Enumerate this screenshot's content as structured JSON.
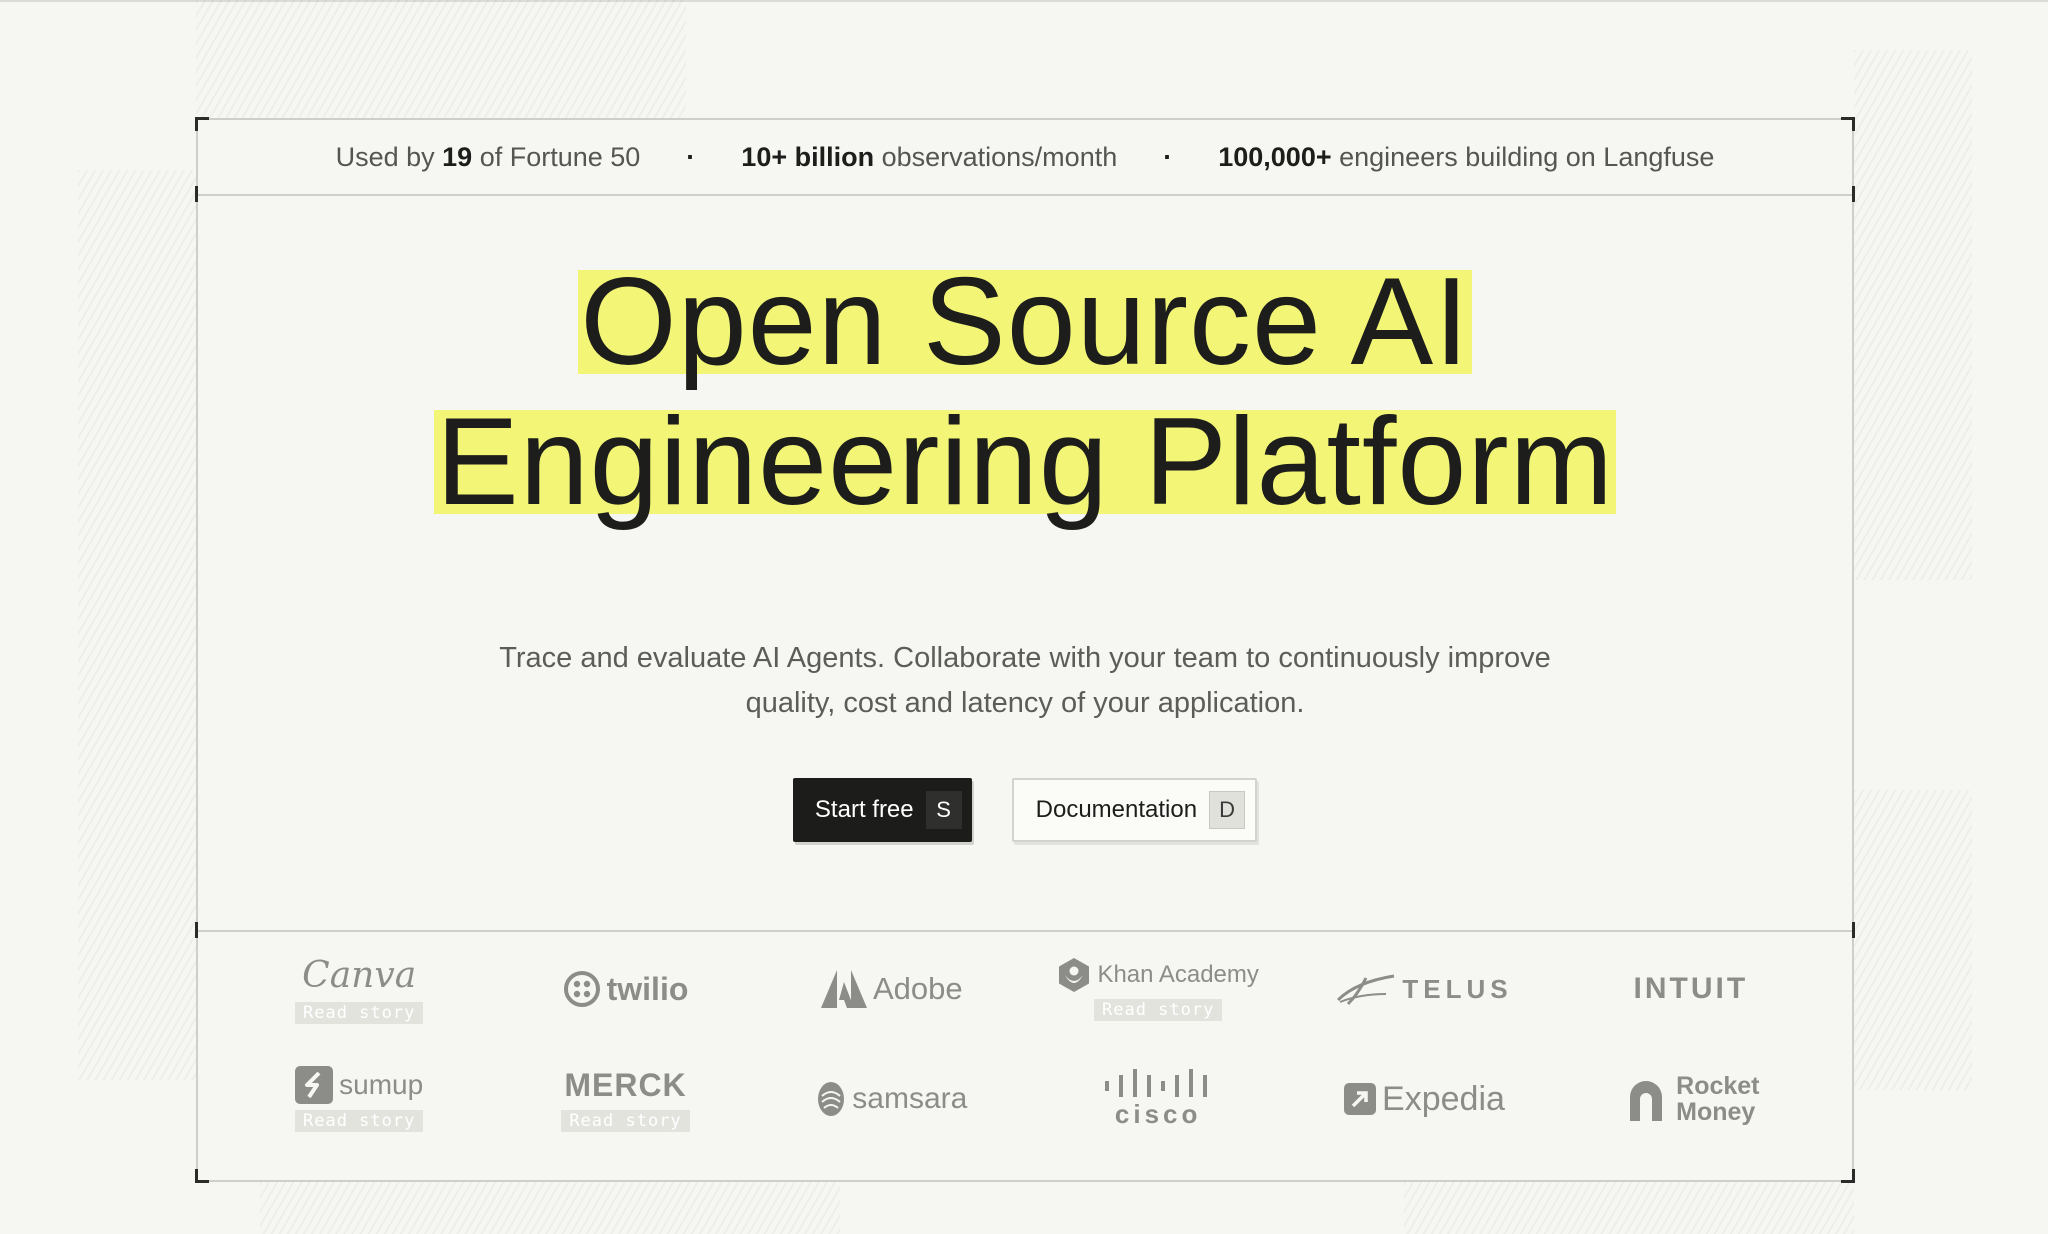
{
  "stats": {
    "item1": {
      "prefix": "Used by ",
      "bold": "19",
      "suffix": " of Fortune 50"
    },
    "item2": {
      "bold": "10+ billion",
      "suffix": " observations/month"
    },
    "item3": {
      "bold": "100,000+",
      "suffix": " engineers building on Langfuse"
    },
    "separator": "·"
  },
  "hero": {
    "line1": "Open Source AI",
    "line2": "Engineering Platform",
    "subtitle_line1": "Trace and evaluate AI Agents. Collaborate with your team to continuously improve",
    "subtitle_line2": "quality, cost and latency of your application."
  },
  "cta": {
    "primary": {
      "label": "Start free",
      "key": "S"
    },
    "secondary": {
      "label": "Documentation",
      "key": "D"
    }
  },
  "logos": {
    "read_story": "Read story",
    "row1": [
      "Canva",
      "twilio",
      "Adobe",
      "Khan Academy",
      "TELUS",
      "INTUIT"
    ],
    "row2": [
      "sumup",
      "MERCK",
      "samsara",
      "cisco",
      "Expedia",
      "Rocket",
      "Money"
    ]
  },
  "colors": {
    "highlight": "#f2f576",
    "background": "#f6f6f2",
    "primary_button": "#1c1c1b"
  }
}
